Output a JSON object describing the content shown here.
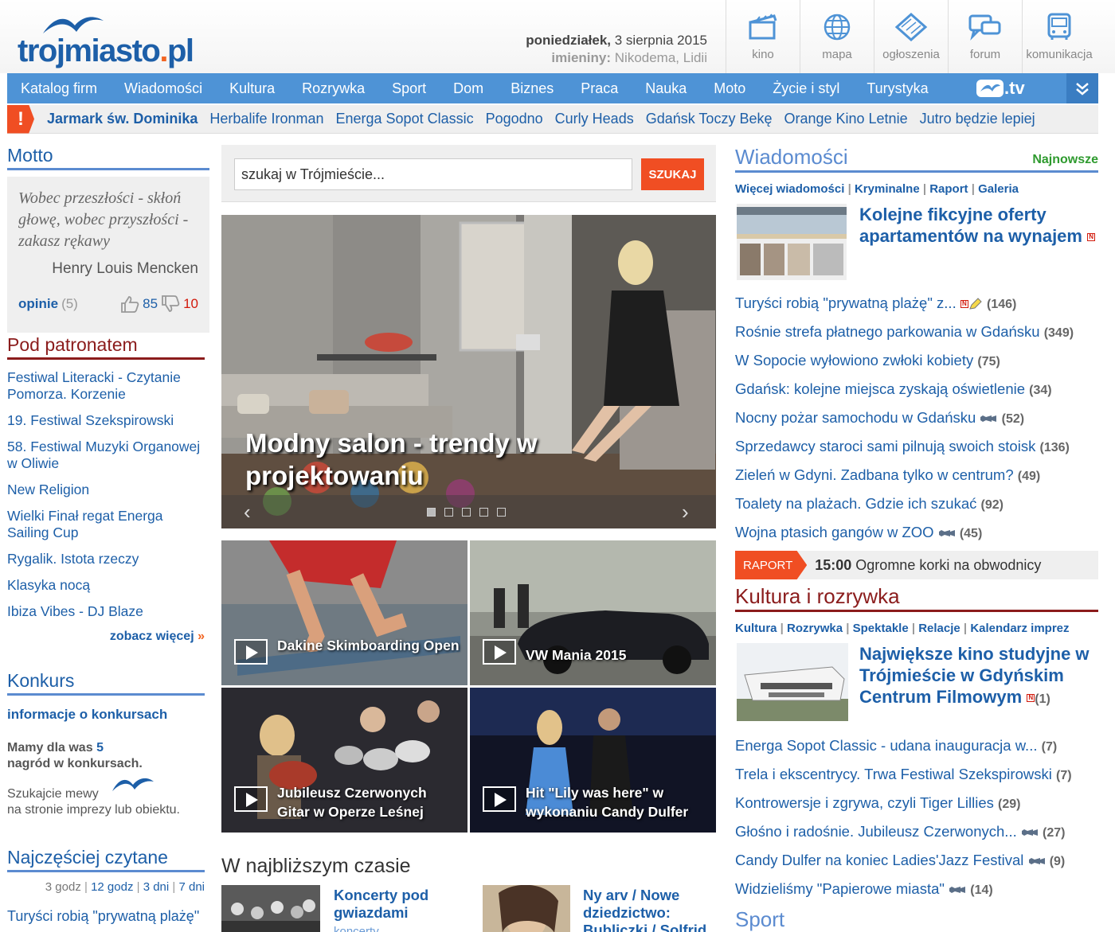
{
  "header": {
    "logo_main": "trojmiasto",
    "logo_dot": ".",
    "logo_tld": "pl",
    "date_day": "poniedziałek,",
    "date_rest": "3 sierpnia 2015",
    "nameday_label": "imieniny:",
    "nameday_names": "Nikodema, Lidii",
    "icons": [
      {
        "label": "kino",
        "icon": "clapperboard-icon"
      },
      {
        "label": "mapa",
        "icon": "globe-icon"
      },
      {
        "label": "ogłoszenia",
        "icon": "tag-icon"
      },
      {
        "label": "forum",
        "icon": "chat-icon"
      },
      {
        "label": "komunikacja",
        "icon": "bus-icon"
      }
    ]
  },
  "nav": {
    "items": [
      "Katalog firm",
      "Wiadomości",
      "Kultura",
      "Rozrywka",
      "Sport",
      "Dom",
      "Biznes",
      "Praca",
      "Nauka",
      "Moto",
      "Życie i styl",
      "Turystyka"
    ],
    "tv_label": ".tv"
  },
  "hotbar": {
    "alert": "!",
    "items": [
      "Jarmark św. Dominika",
      "Herbalife Ironman",
      "Energa Sopot Classic",
      "Pogodno",
      "Curly Heads",
      "Gdańsk Toczy Bekę",
      "Orange Kino Letnie",
      "Jutro będzie lepiej"
    ]
  },
  "motto": {
    "title": "Motto",
    "quote": "Wobec przeszłości - skłoń głowę, wobec przyszłości - zakasz rękawy",
    "author": "Henry Louis Mencken",
    "opinie_label": "opinie",
    "opinie_count": "(5)",
    "likes": "85",
    "dislikes": "10"
  },
  "patronat": {
    "title": "Pod patronatem",
    "items": [
      "Festiwal Literacki - Czytanie Pomorza. Korzenie",
      "19. Festiwal Szekspirowski",
      "58. Festiwal Muzyki Organowej w Oliwie",
      "New Religion",
      "Wielki Finał regat Energa Sailing Cup",
      "Rygalik. Istota rzeczy",
      "Klasyka nocą",
      "Ibiza Vibes - DJ Blaze"
    ],
    "more": "zobacz więcej",
    "more_arrow": "»"
  },
  "konkurs": {
    "title": "Konkurs",
    "info": "informacje o konkursach",
    "mamy_pre": "Mamy dla was",
    "mamy_num": "5",
    "mamy_post": "nagród w konkursach.",
    "szuk_1": "Szukajcie mewy",
    "szuk_2": "na stronie imprezy lub obiektu."
  },
  "najczesciej": {
    "title": "Najczęściej czytane",
    "tabs": [
      "3 godz",
      "12 godz",
      "3 dni",
      "7 dni"
    ],
    "first": "Turyści robią \"prywatną plażę\""
  },
  "search": {
    "value": "szukaj w Trójmieście...",
    "button": "SZUKAJ"
  },
  "hero": {
    "title": "Modny salon - trendy w projektowaniu",
    "prev": "‹",
    "next": "›"
  },
  "tiles": [
    {
      "title": "Dakine Skimboarding Open"
    },
    {
      "title": "VW Mania 2015"
    },
    {
      "title": "Jubileusz Czerwonych Gitar w Operze Leśnej"
    },
    {
      "title": "Hit \"Lily was here\" w wykonaniu Candy Dulfer"
    }
  ],
  "soon": {
    "title": "W najbliższym czasie",
    "items": [
      {
        "title": "Koncerty pod gwiazdami",
        "sub": "koncerty"
      },
      {
        "title": "Ny arv / Nowe dziedzictwo: Bubliczki / Solfrid",
        "sub": ""
      }
    ]
  },
  "news": {
    "title": "Wiadomości",
    "newest": "Najnowsze",
    "sublinks": [
      "Więcej wiadomości",
      "Kryminalne",
      "Raport",
      "Galeria"
    ],
    "featured": "Kolejne fikcyjne oferty apartamentów na wynajem",
    "items": [
      {
        "text": "Turyści robią \"prywatną plażę\" z...",
        "count": "(146)",
        "n": true,
        "cam": false,
        "pen": true
      },
      {
        "text": "Rośnie strefa płatnego parkowania w Gdańsku",
        "count": "(349)"
      },
      {
        "text": "W Sopocie wyłowiono zwłoki kobiety",
        "count": "(75)"
      },
      {
        "text": "Gdańsk: kolejne miejsca zyskają oświetlenie",
        "count": "(34)"
      },
      {
        "text": "Nocny pożar samochodu w Gdańsku",
        "count": "(52)",
        "cam": true
      },
      {
        "text": "Sprzedawcy staroci sami pilnują swoich stoisk",
        "count": "(136)"
      },
      {
        "text": "Zieleń w Gdyni. Zadbana tylko w centrum?",
        "count": "(49)"
      },
      {
        "text": "Toalety na plażach. Gdzie ich szukać",
        "count": "(92)"
      },
      {
        "text": "Wojna ptasich gangów w ZOO",
        "count": "(45)",
        "cam": true
      }
    ]
  },
  "raport": {
    "tag": "RAPORT",
    "time": "15:00",
    "text": "Ogromne korki na obwodnicy"
  },
  "kultura": {
    "title": "Kultura i rozrywka",
    "sublinks": [
      "Kultura",
      "Rozrywka",
      "Spektakle",
      "Relacje",
      "Kalendarz imprez"
    ],
    "featured": "Największe kino studyjne w Trójmieście w Gdyńskim Centrum Filmowym",
    "featured_count": "(1)",
    "items": [
      {
        "text": "Energa Sopot Classic - udana inauguracja w...",
        "count": "(7)"
      },
      {
        "text": "Trela i ekscentrycy. Trwa Festiwal Szekspirowski",
        "count": "(7)"
      },
      {
        "text": "Kontrowersje i zgrywa, czyli Tiger Lillies",
        "count": "(29)"
      },
      {
        "text": "Głośno i radośnie. Jubileusz Czerwonych...",
        "count": "(27)",
        "cam": true
      },
      {
        "text": "Candy Dulfer na koniec Ladies'Jazz Festival",
        "count": "(9)",
        "cam": true
      },
      {
        "text": "Widzieliśmy \"Papierowe miasta\"",
        "count": "(14)",
        "cam": true
      }
    ]
  },
  "sport": {
    "title": "Sport"
  },
  "colors": {
    "brand": "#1d5fa8",
    "nav": "#4e93d6",
    "accent": "#f04e23",
    "dark_red": "#8b1c1c"
  }
}
